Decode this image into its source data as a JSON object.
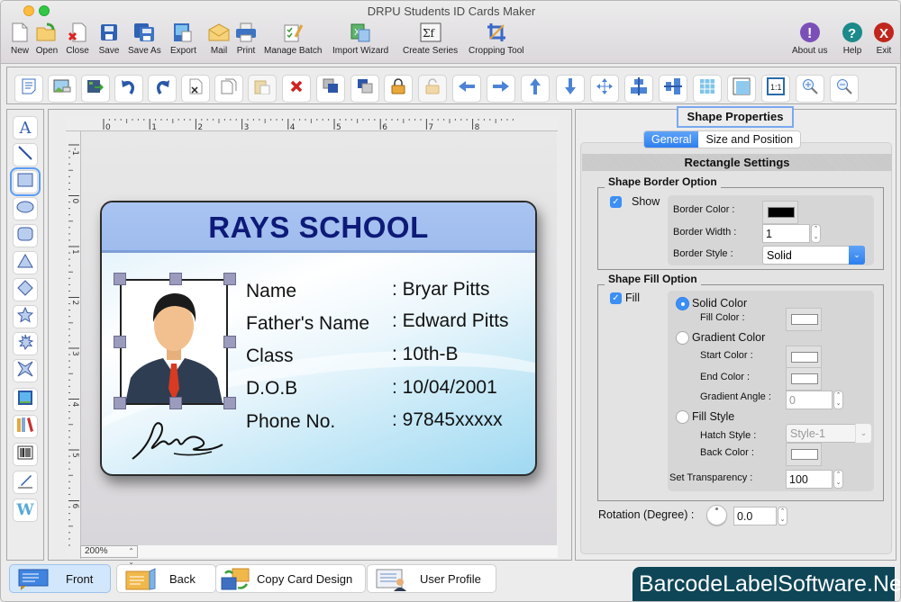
{
  "window": {
    "title": "DRPU Students ID Cards Maker"
  },
  "toolbar": {
    "items": [
      {
        "label": "New",
        "icon": "new-document-icon"
      },
      {
        "label": "Open",
        "icon": "open-folder-icon"
      },
      {
        "label": "Close",
        "icon": "close-document-icon"
      },
      {
        "label": "Save",
        "icon": "save-icon"
      },
      {
        "label": "Save As",
        "icon": "save-as-icon"
      },
      {
        "label": "Export",
        "icon": "export-icon"
      },
      {
        "label": "Mail",
        "icon": "mail-icon"
      },
      {
        "label": "Print",
        "icon": "printer-icon"
      },
      {
        "label": "Manage Batch",
        "icon": "manage-batch-icon"
      },
      {
        "label": "Import Wizard",
        "icon": "import-wizard-icon"
      },
      {
        "label": "Create Series",
        "icon": "sigma-fx-icon"
      },
      {
        "label": "Cropping Tool",
        "icon": "crop-icon"
      }
    ],
    "right_items": [
      {
        "label": "About us",
        "icon": "info-exclamation-icon",
        "color": "#7b4fb8"
      },
      {
        "label": "Help",
        "icon": "help-question-icon",
        "color": "#1c8a8a"
      },
      {
        "label": "Exit",
        "icon": "exit-x-icon",
        "color": "#c0261d"
      }
    ]
  },
  "icon_toolbar": [
    "properties",
    "insert-image",
    "export-image",
    "undo",
    "redo",
    "cut",
    "copy",
    "paste",
    "delete",
    "bring-to-front",
    "send-to-back",
    "lock",
    "unlock",
    "move-left",
    "move-right",
    "move-up",
    "move-down",
    "center",
    "align-horizontal-center",
    "align-vertical-center",
    "grid",
    "ruler",
    "actual-size",
    "zoom-in",
    "zoom-out"
  ],
  "left_tools": [
    "text",
    "line",
    "rectangle",
    "ellipse",
    "rounded-rectangle",
    "triangle",
    "diamond",
    "star",
    "starburst",
    "four-point-star",
    "picture",
    "library",
    "barcode",
    "signature",
    "watermark"
  ],
  "selected_tool": "rectangle",
  "ruler": {
    "h_ticks": [
      "0",
      "1",
      "2",
      "3",
      "4",
      "5",
      "6",
      "7",
      "8"
    ],
    "v_ticks": [
      "-1",
      "0",
      "1",
      "2",
      "3",
      "4",
      "5",
      "6"
    ]
  },
  "zoom": {
    "value": "200%"
  },
  "card": {
    "school": "RAYS SCHOOL",
    "fields": [
      {
        "label": "Name",
        "value": ": Bryar Pitts"
      },
      {
        "label": "Father's Name",
        "value": ": Edward Pitts"
      },
      {
        "label": "Class",
        "value": ": 10th-B"
      },
      {
        "label": "D.O.B",
        "value": ": 10/04/2001"
      },
      {
        "label": "Phone No.",
        "value": ": 97845xxxxx"
      }
    ],
    "colors": {
      "header": "#a9c4f1",
      "title": "#0d1a78"
    }
  },
  "properties": {
    "title": "Shape Properties",
    "tabs": [
      {
        "label": "General",
        "active": true
      },
      {
        "label": "Size and Position",
        "active": false
      }
    ],
    "section": "Rectangle Settings",
    "border": {
      "group": "Shape Border Option",
      "show_label": "Show",
      "show_checked": true,
      "color_label": "Border Color :",
      "color": "#000000",
      "width_label": "Border Width :",
      "width": "1",
      "style_label": "Border Style :",
      "style": "Solid"
    },
    "fill": {
      "group": "Shape Fill Option",
      "fill_label": "Fill",
      "fill_checked": true,
      "solid_label": "Solid Color",
      "fill_color_label": "Fill Color :",
      "fill_color": "#ffffff",
      "gradient_label": "Gradient Color",
      "start_label": "Start Color :",
      "start_color": "#ffffff",
      "end_label": "End Color :",
      "end_color": "#ffffff",
      "angle_label": "Gradient Angle :",
      "angle": "0",
      "fill_style_label": "Fill Style",
      "hatch_label": "Hatch Style :",
      "hatch": "Style-1",
      "back_label": "Back Color :",
      "back_color": "#ffffff",
      "transparency_label": "Set Transparency :",
      "transparency": "100",
      "selected": "Solid Color"
    },
    "rotation_label": "Rotation (Degree) :",
    "rotation": "0.0"
  },
  "bottom": {
    "buttons": [
      {
        "label": "Front",
        "selected": true
      },
      {
        "label": "Back",
        "selected": false
      },
      {
        "label": "Copy Card Design",
        "selected": false
      },
      {
        "label": "User Profile",
        "selected": false
      }
    ],
    "watermark": "BarcodeLabelSoftware.Net"
  }
}
